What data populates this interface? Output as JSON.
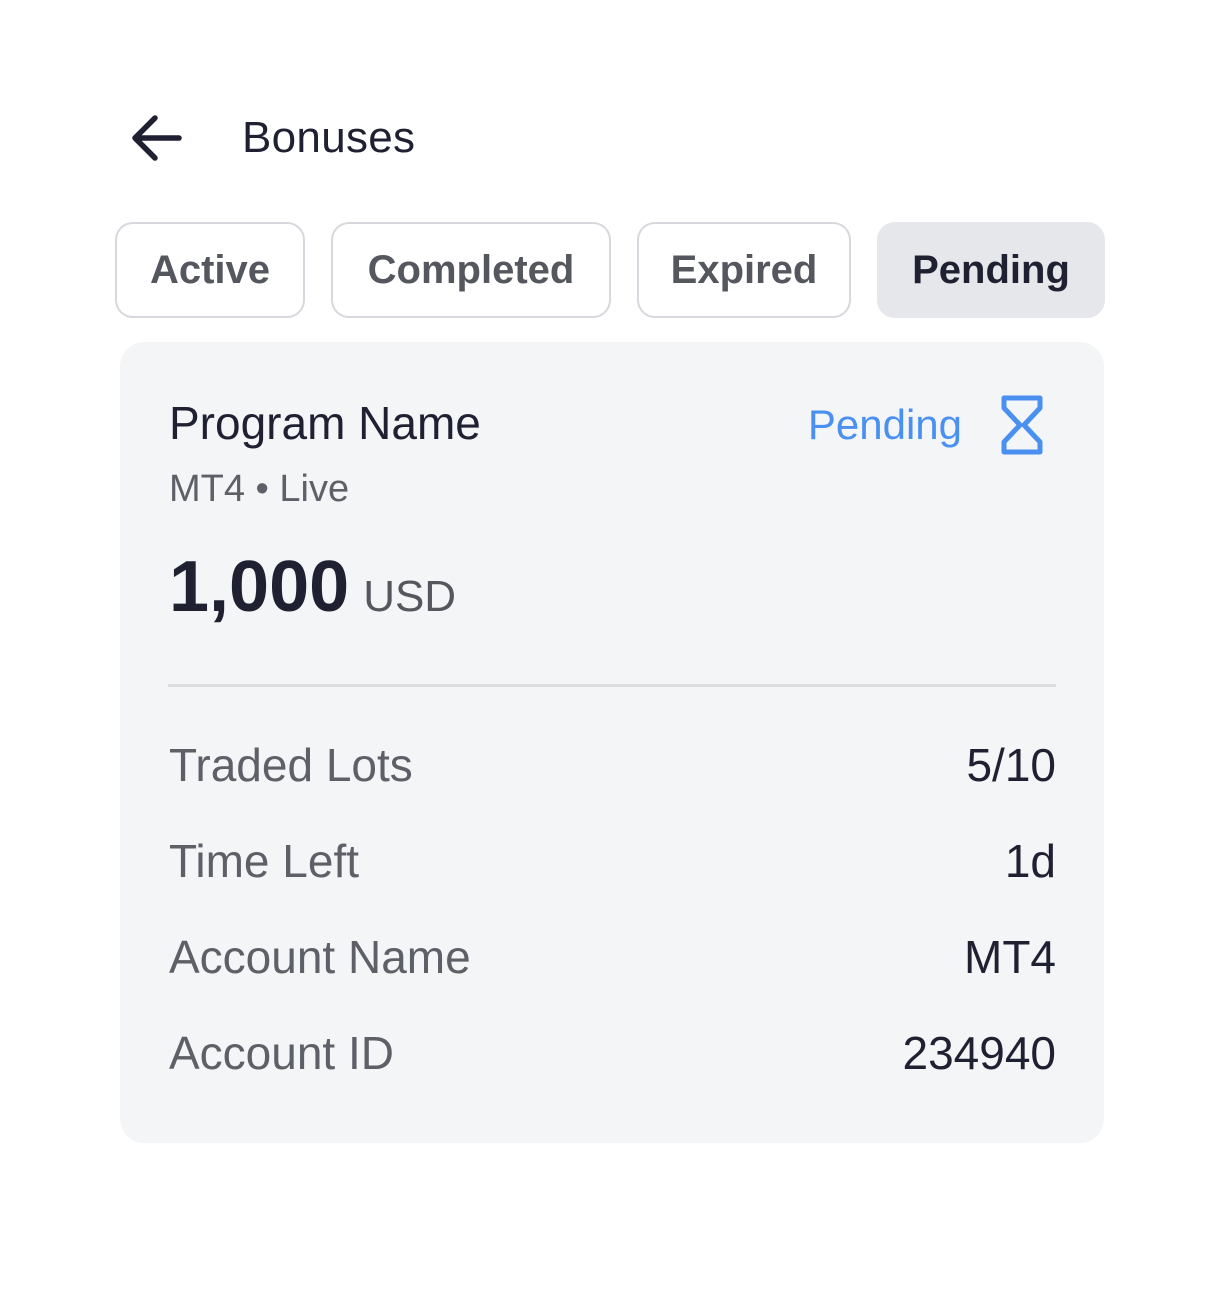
{
  "header": {
    "title": "Bonuses",
    "back_icon": "arrow-left-icon"
  },
  "tabs": [
    {
      "label": "Active",
      "selected": false
    },
    {
      "label": "Completed",
      "selected": false
    },
    {
      "label": "Expired",
      "selected": false
    },
    {
      "label": "Pending",
      "selected": true
    }
  ],
  "card": {
    "program_name": "Program Name",
    "subtitle": "MT4 • Live",
    "status": {
      "label": "Pending",
      "icon": "hourglass-icon",
      "color": "#4a90f0"
    },
    "amount": {
      "value": "1,000",
      "currency": "USD"
    },
    "details": [
      {
        "label": "Traded Lots",
        "value": "5/10"
      },
      {
        "label": "Time Left",
        "value": "1d"
      },
      {
        "label": "Account Name",
        "value": "MT4"
      },
      {
        "label": "Account ID",
        "value": "234940"
      }
    ]
  }
}
